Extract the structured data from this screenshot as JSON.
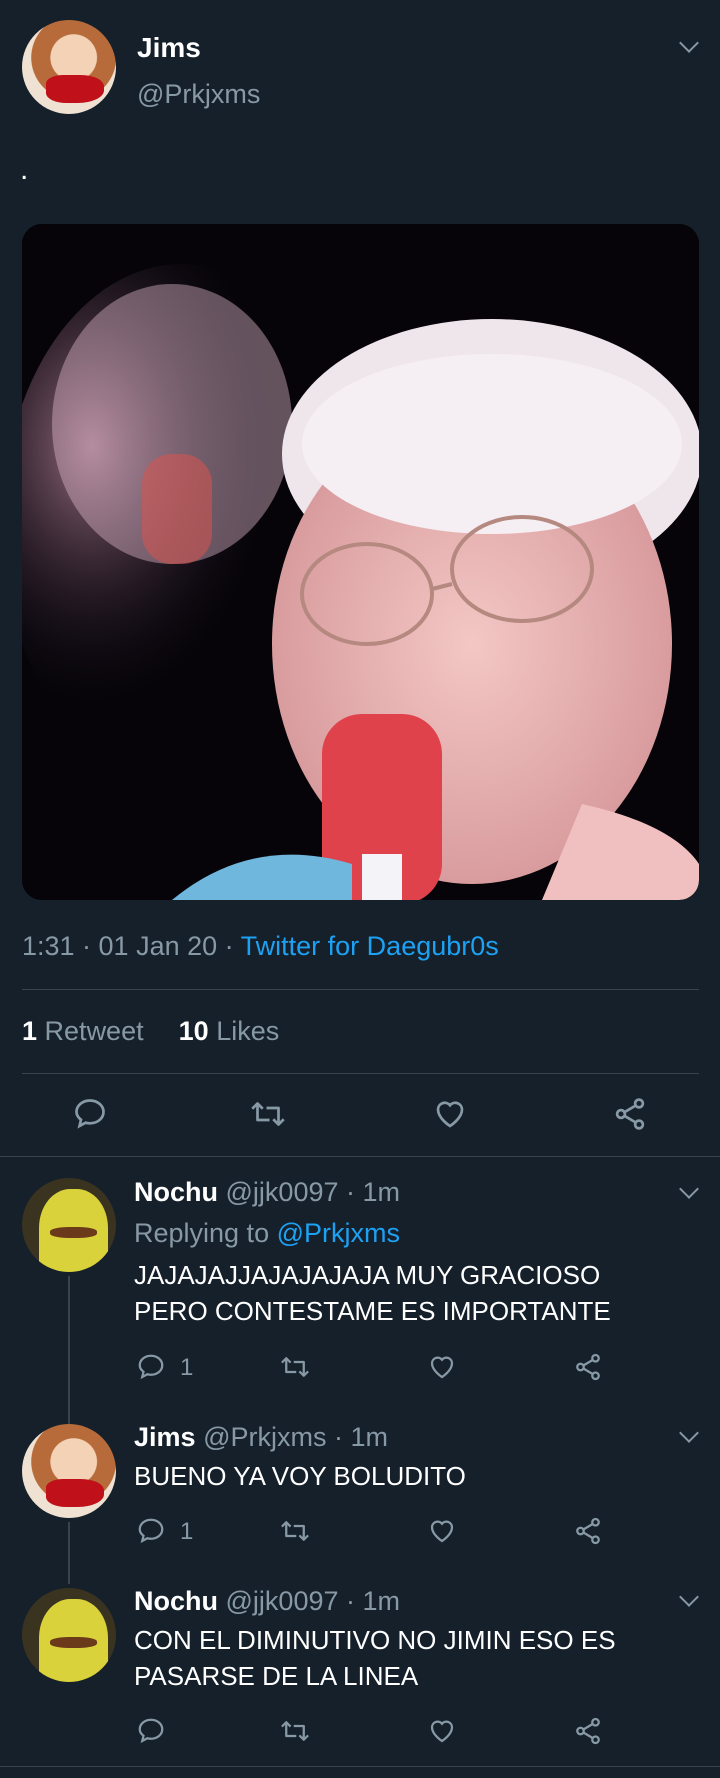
{
  "main_tweet": {
    "author_name": "Jims",
    "author_handle": "@Prkjxms",
    "text": ".",
    "time": "1:31 · 01 Jan 20 · ",
    "source": "Twitter for Daegubr0s",
    "retweets_count": "1",
    "retweets_label": "Retweet",
    "likes_count": "10",
    "likes_label": "Likes"
  },
  "replies": [
    {
      "name": "Nochu",
      "meta": "@jjk0097 · 1m",
      "replying_prefix": "Replying to ",
      "replying_handle": "@Prkjxms",
      "text_line1": "JAJAJAJJAJAJAJAJA MUY GRACIOSO",
      "text_line2": "PERO CONTESTAME ES IMPORTANTE",
      "reply_count": "1"
    },
    {
      "name": "Jims",
      "meta": "@Prkjxms · 1m",
      "text_line1": "BUENO YA VOY BOLUDITO",
      "reply_count": "1"
    },
    {
      "name": "Nochu",
      "meta": "@jjk0097 · 1m",
      "text_line1": "CON EL DIMINUTIVO NO JIMIN ESO ES",
      "text_line2": "PASARSE DE LA LINEA"
    }
  ],
  "colors": {
    "background": "#15202b",
    "link": "#1da1f2",
    "muted": "#8899a6",
    "divider": "#38444d"
  }
}
